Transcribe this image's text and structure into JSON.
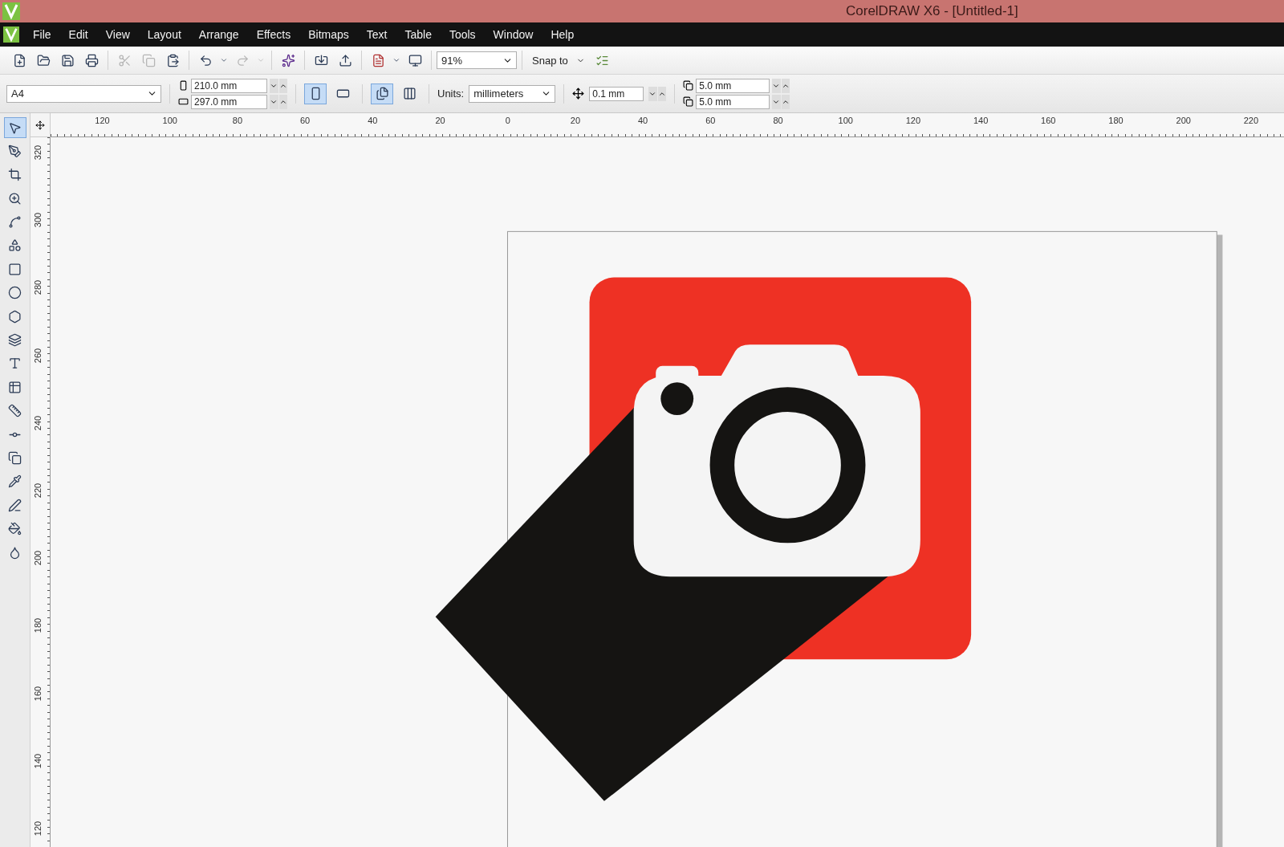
{
  "window": {
    "title": "CorelDRAW X6 - [Untitled-1]"
  },
  "menu": [
    "File",
    "Edit",
    "View",
    "Layout",
    "Arrange",
    "Effects",
    "Bitmaps",
    "Text",
    "Table",
    "Tools",
    "Window",
    "Help"
  ],
  "standard_toolbar": {
    "buttons": [
      {
        "disabled": false
      },
      {
        "disabled": false
      },
      {
        "disabled": false
      },
      {
        "disabled": false
      },
      {
        "disabled": true
      },
      {
        "disabled": true
      },
      {
        "disabled": false
      },
      {
        "disabled": false
      },
      {
        "disabled": false
      },
      {
        "disabled": true
      },
      {
        "disabled": true
      },
      {
        "disabled": false
      },
      {
        "disabled": false
      },
      {
        "disabled": false
      }
    ],
    "zoom": "91%",
    "snap": "Snap to"
  },
  "property_bar": {
    "page_size": "A4",
    "width": "210.0 mm",
    "height": "297.0 mm",
    "orientation": [
      {
        "selected": true
      },
      {
        "selected": false
      }
    ],
    "page_scope": [
      {
        "selected": true
      },
      {
        "selected": false
      }
    ],
    "units_label": "Units:",
    "units": "millimeters",
    "nudge": "0.1 mm",
    "duplicate_x": "5.0 mm",
    "duplicate_y": "5.0 mm"
  },
  "toolbox": [
    {
      "selected": true
    },
    {
      "selected": false
    },
    {
      "selected": false
    },
    {
      "selected": false
    },
    {
      "selected": false
    },
    {
      "selected": false
    },
    {
      "selected": false
    },
    {
      "selected": false
    },
    {
      "selected": false
    },
    {
      "selected": false
    },
    {
      "selected": false
    },
    {
      "selected": false
    },
    {
      "selected": false
    },
    {
      "selected": false
    },
    {
      "selected": false
    },
    {
      "selected": false
    },
    {
      "selected": false
    },
    {
      "selected": false
    },
    {
      "selected": false
    }
  ],
  "horizontal_ruler": [
    "120",
    "100",
    "80",
    "60",
    "40",
    "20",
    "0",
    "20",
    "40",
    "60",
    "80",
    "100",
    "120",
    "140",
    "160",
    "180",
    "200",
    "220"
  ],
  "vertical_ruler": [
    "320",
    "300",
    "280",
    "260",
    "240",
    "220",
    "200",
    "180",
    "160",
    "140",
    "120"
  ]
}
